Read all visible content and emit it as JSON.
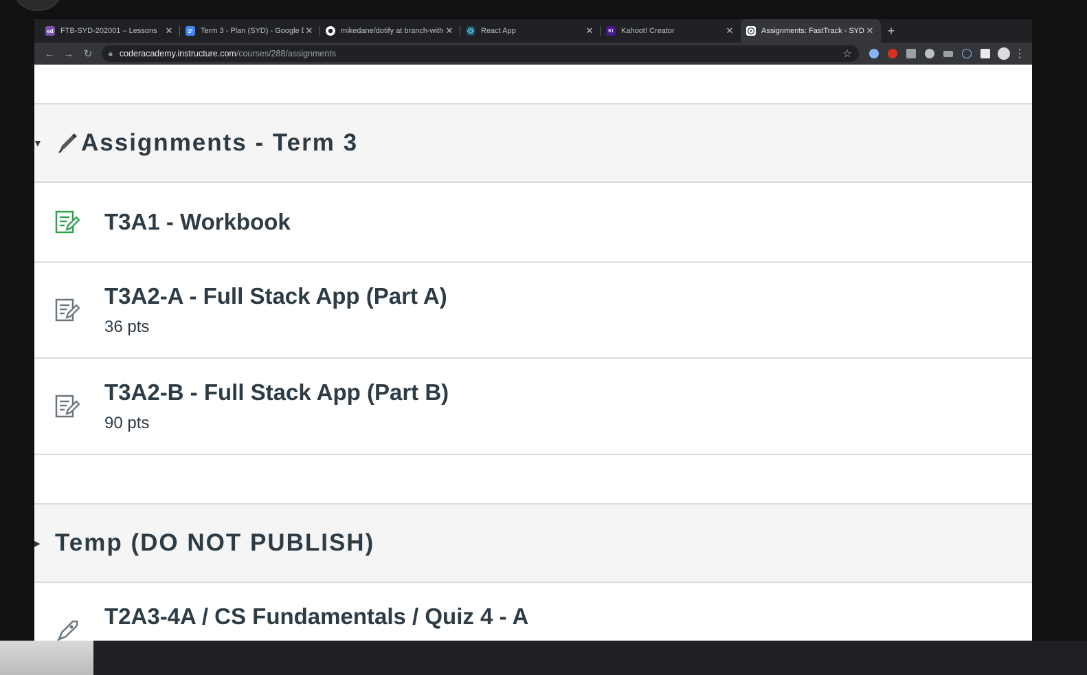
{
  "browser": {
    "tabs": [
      {
        "label": "FTB-SYD-202001 – Lessons",
        "favicon": "ed-icon",
        "favicon_text": "ed",
        "favicon_color": "#7b52ab",
        "active": false
      },
      {
        "label": "Term 3 - Plan (SYD) - Google D",
        "favicon": "google-docs-icon",
        "favicon_color": "#4285f4",
        "active": false
      },
      {
        "label": "mikedane/dotify at branch-with",
        "favicon": "github-icon",
        "favicon_color": "#ffffff",
        "active": false
      },
      {
        "label": "React App",
        "favicon": "react-icon",
        "favicon_color": "#61dafb",
        "active": false
      },
      {
        "label": "Kahoot! Creator",
        "favicon": "kahoot-icon",
        "favicon_color": "#46178f",
        "active": false
      },
      {
        "label": "Assignments: FastTrack - SYD",
        "favicon": "canvas-icon",
        "favicon_color": "#e8eaed",
        "active": true
      }
    ],
    "url_host": "coderacademy.instructure.com",
    "url_path": "/courses/288/assignments"
  },
  "groups": [
    {
      "title": "Assignments - Term 3",
      "expanded": true,
      "items": [
        {
          "title": "T3A1 - Workbook",
          "points": "",
          "icon": "assignment-icon",
          "icon_color": "#2fa34d"
        },
        {
          "title": "T3A2-A - Full Stack App (Part A)",
          "points": "36 pts",
          "icon": "assignment-icon",
          "icon_color": "#6b7780"
        },
        {
          "title": "T3A2-B - Full Stack App (Part B)",
          "points": "90 pts",
          "icon": "assignment-icon",
          "icon_color": "#6b7780"
        }
      ]
    },
    {
      "title": "Temp (DO NOT PUBLISH)",
      "expanded": false,
      "items": [
        {
          "title": "T2A3-4A / CS Fundamentals / Quiz 4 - A",
          "points": "",
          "icon": "quiz-rocket-icon",
          "icon_color": "#6b7780"
        }
      ]
    }
  ]
}
